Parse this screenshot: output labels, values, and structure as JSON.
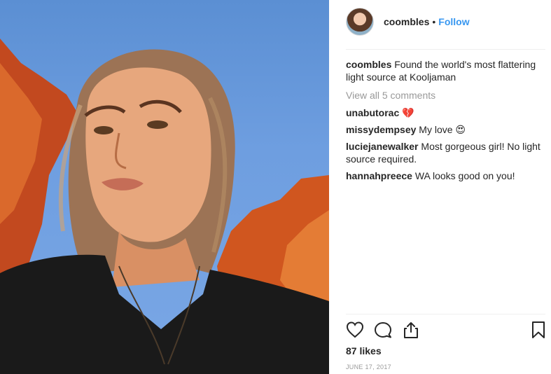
{
  "post": {
    "username": "coombles",
    "separator": "•",
    "follow_label": "Follow",
    "caption_user": "coombles",
    "caption_text": "Found the world's most flattering light source at Kooljaman",
    "view_all_label": "View all 5 comments",
    "comments": [
      {
        "user": "unabutorac",
        "text": "💔"
      },
      {
        "user": "missydempsey",
        "text": "My love 😍"
      },
      {
        "user": "luciejanewalker",
        "text": "Most gorgeous girl! No light source required."
      },
      {
        "user": "hannahpreece",
        "text": "WA looks good on you!"
      }
    ],
    "likes": "87 likes",
    "date": "JUNE 17, 2017"
  },
  "icons": [
    "heart-icon",
    "comment-icon",
    "share-icon",
    "bookmark-icon"
  ],
  "colors": {
    "link": "#3897f0",
    "muted": "#999999",
    "text": "#262626"
  }
}
